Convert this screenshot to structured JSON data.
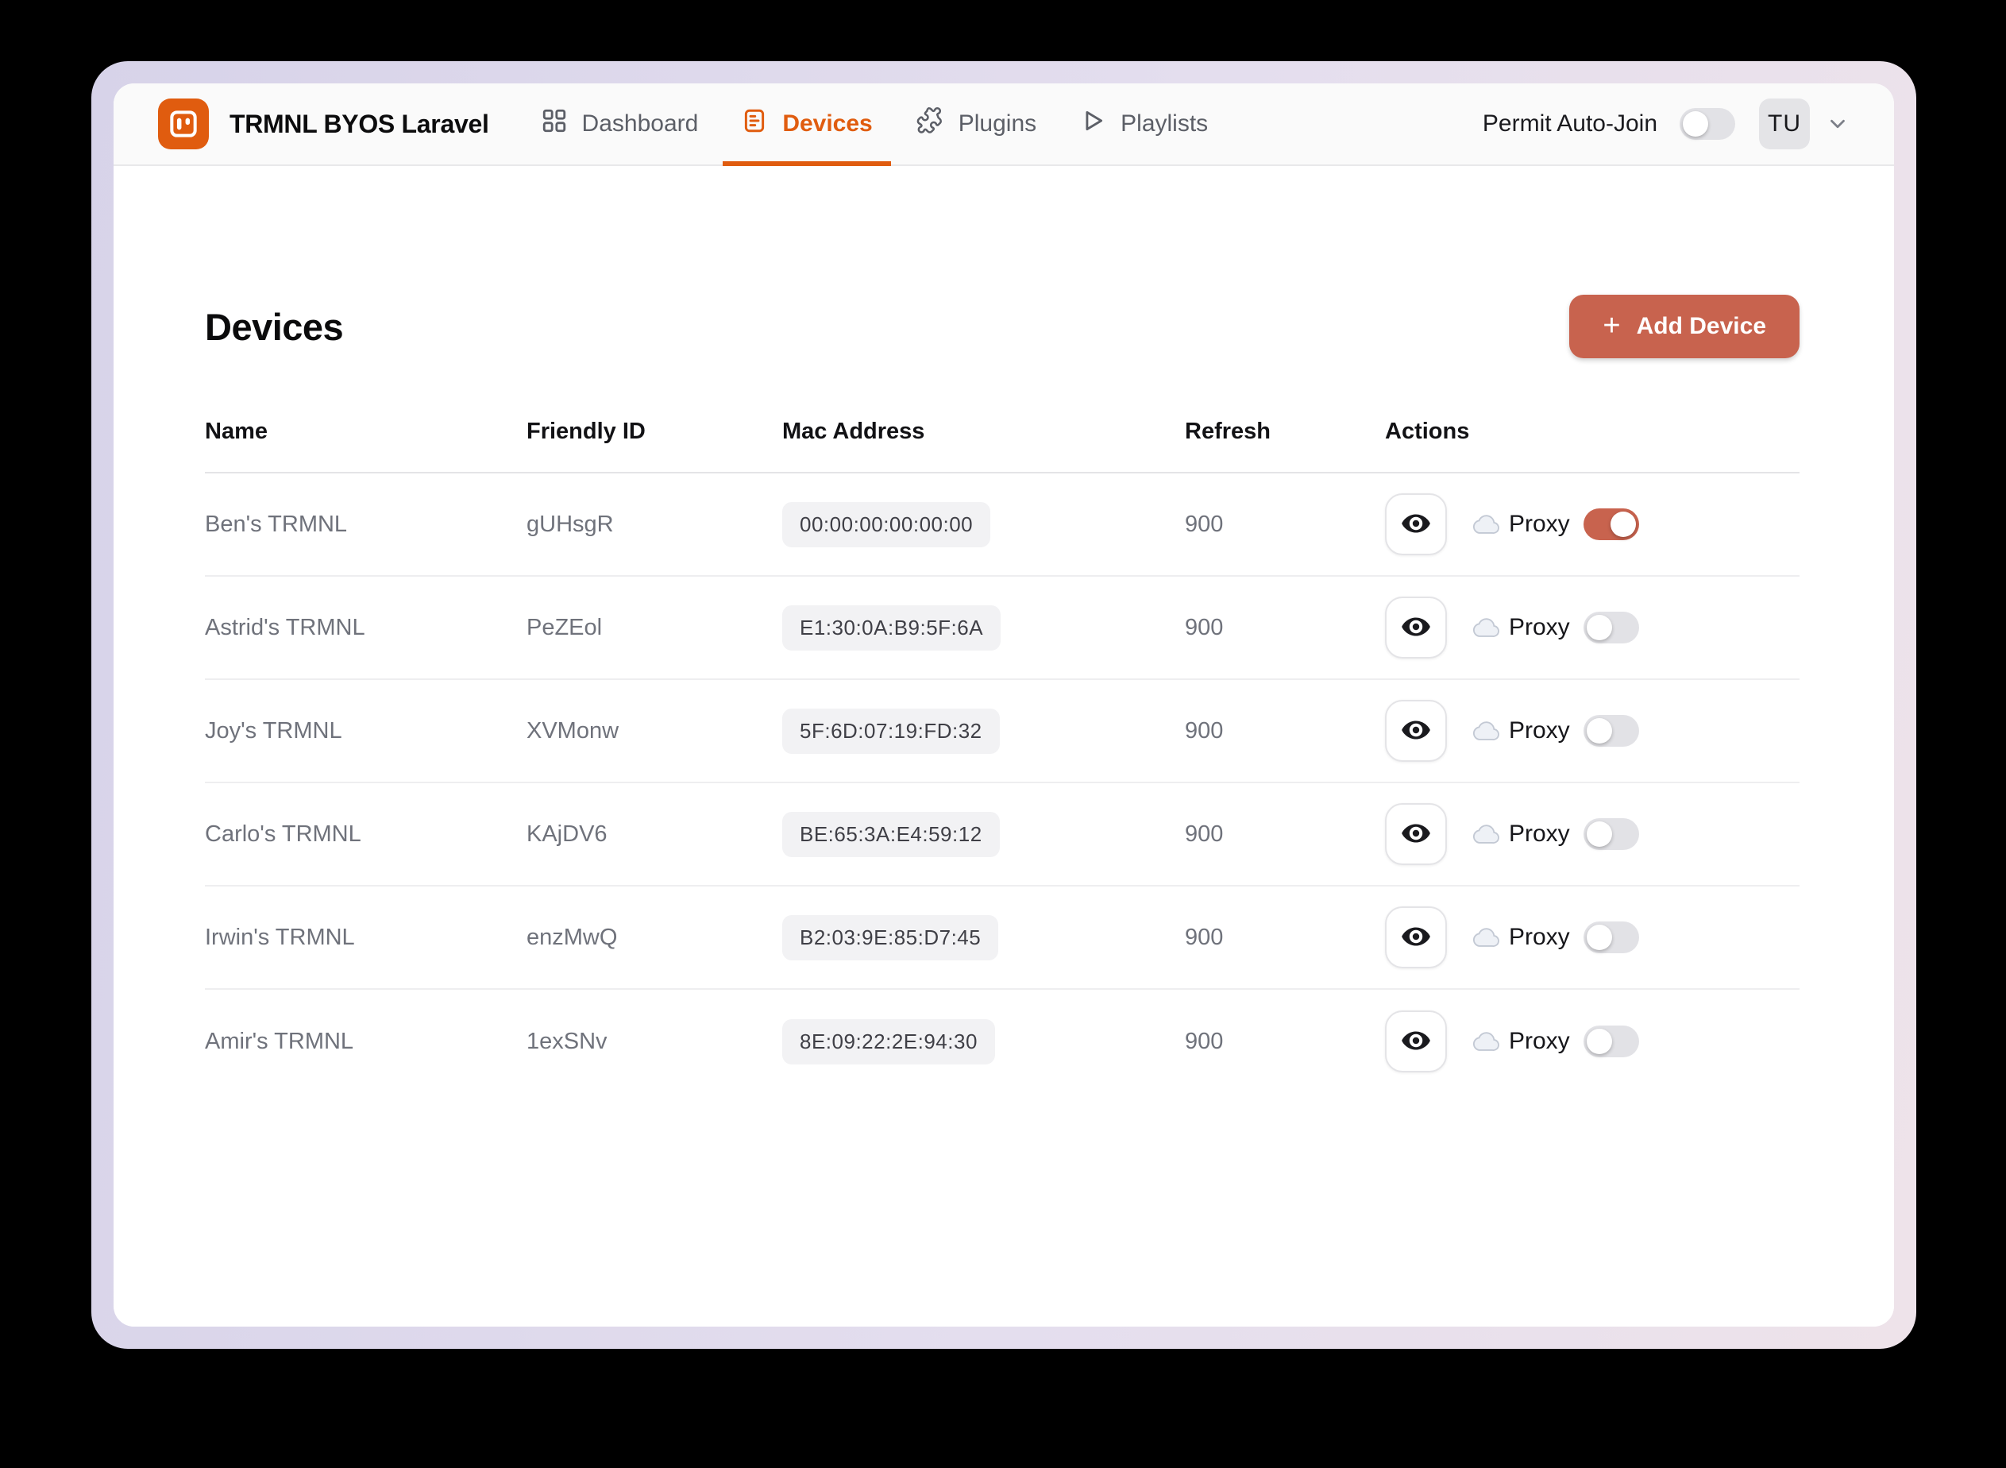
{
  "header": {
    "app_title": "TRMNL BYOS Laravel",
    "nav": [
      {
        "label": "Dashboard",
        "icon": "grid-icon",
        "active": false
      },
      {
        "label": "Devices",
        "icon": "device-list-icon",
        "active": true
      },
      {
        "label": "Plugins",
        "icon": "puzzle-icon",
        "active": false
      },
      {
        "label": "Playlists",
        "icon": "play-icon",
        "active": false
      }
    ],
    "permit_auto_join": {
      "label": "Permit Auto-Join",
      "enabled": false
    },
    "user": {
      "initials": "TU"
    }
  },
  "page": {
    "title": "Devices",
    "add_button": {
      "label": "Add Device",
      "plus": "+"
    }
  },
  "table": {
    "headers": [
      "Name",
      "Friendly ID",
      "Mac Address",
      "Refresh",
      "Actions"
    ],
    "proxy_label": "Proxy",
    "rows": [
      {
        "name": "Ben's TRMNL",
        "friendly_id": "gUHsgR",
        "mac": "00:00:00:00:00:00",
        "refresh": "900",
        "proxy_enabled": true
      },
      {
        "name": "Astrid's TRMNL",
        "friendly_id": "PeZEol",
        "mac": "E1:30:0A:B9:5F:6A",
        "refresh": "900",
        "proxy_enabled": false
      },
      {
        "name": "Joy's TRMNL",
        "friendly_id": "XVMonw",
        "mac": "5F:6D:07:19:FD:32",
        "refresh": "900",
        "proxy_enabled": false
      },
      {
        "name": "Carlo's TRMNL",
        "friendly_id": "KAjDV6",
        "mac": "BE:65:3A:E4:59:12",
        "refresh": "900",
        "proxy_enabled": false
      },
      {
        "name": "Irwin's TRMNL",
        "friendly_id": "enzMwQ",
        "mac": "B2:03:9E:85:D7:45",
        "refresh": "900",
        "proxy_enabled": false
      },
      {
        "name": "Amir's TRMNL",
        "friendly_id": "1exSNv",
        "mac": "8E:09:22:2E:94:30",
        "refresh": "900",
        "proxy_enabled": false
      }
    ]
  },
  "colors": {
    "accent": "#e05c0f",
    "primary_button": "#c8634e",
    "toggle_on": "#c8634e",
    "frame_gradient_start": "#d7d3e9",
    "frame_gradient_end": "#eee3ea"
  }
}
